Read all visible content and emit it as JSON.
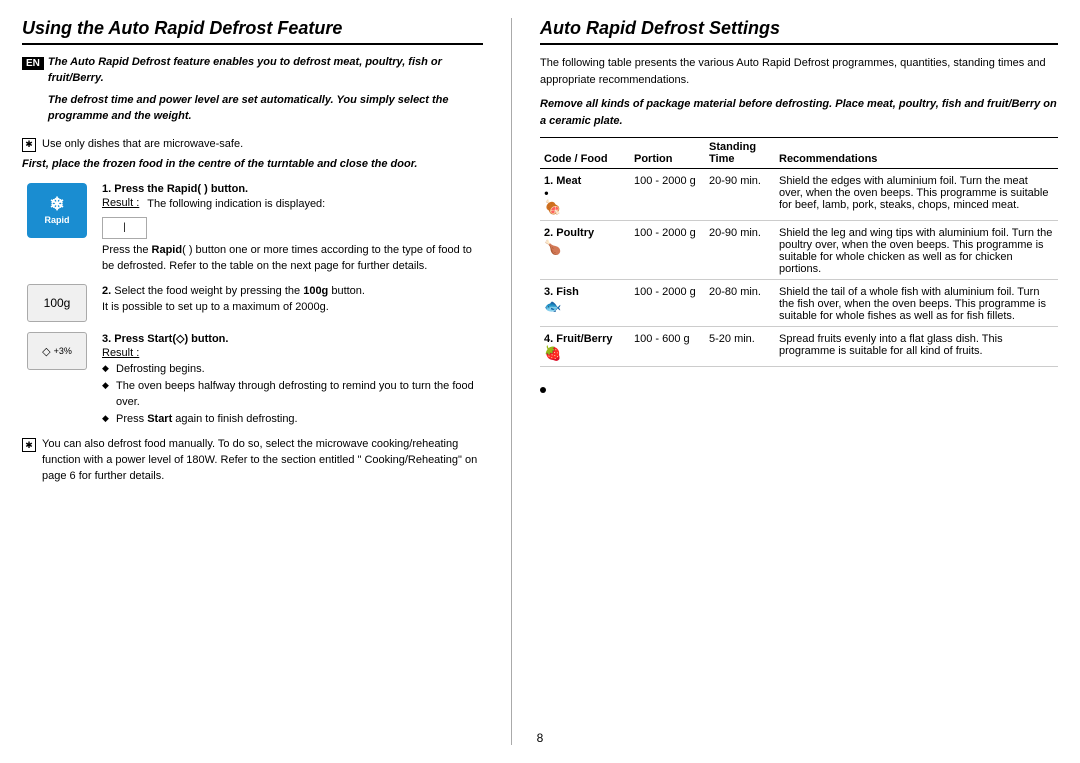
{
  "left": {
    "title": "Using the Auto Rapid Defrost Feature",
    "en_badge": "EN",
    "intro": {
      "line1": "The Auto Rapid Defrost feature enables you to defrost  meat, poultry, fish or fruit/Berry.",
      "line2": "The defrost time and power level are set automatically. You simply select the programme and the weight.",
      "note": "Use only dishes that are microwave-safe.",
      "line3": "First, place the frozen food in the centre of the turntable and close the door."
    },
    "steps": [
      {
        "number": "1.",
        "text_before": "Press the ",
        "bold_word": "Rapid",
        "bold_suffix": "(   ) button.",
        "result_label": "Result :",
        "result_text": "The following indication is displayed:",
        "sub_text": "Press the Rapid(   ) button one or more times according to the type of food to be defrosted. Refer to the table on the next page for further details."
      },
      {
        "number": "2.",
        "text": "Select the food weight by pressing the ",
        "bold_word": "100g",
        "text_after": " button.\nIt is possible to set up to a maximum of 2000g."
      },
      {
        "number": "3.",
        "text": "Press ",
        "bold_word": "Start",
        "text_after": "(   ) button.",
        "result_label": "Result :",
        "bullets": [
          "Defrosting begins.",
          "The oven beeps halfway through defrosting to remind you to turn the food over.",
          "Press Start again to finish defrosting."
        ]
      }
    ],
    "manual_note": "You can also defrost food manually. To do so, select the microwave cooking/reheating function with a power level of 180W. Refer to the section entitled \" Cooking/Reheating\" on page 6  for further details."
  },
  "right": {
    "title": "Auto Rapid Defrost Settings",
    "intro1": "The following table presents the various Auto Rapid Defrost programmes, quantities, standing times and appropriate recommendations.",
    "intro2": "Remove all kinds of package material before defrosting. Place meat, poultry, fish and fruit/Berry on a ceramic plate.",
    "table": {
      "headers": [
        "Code / Food",
        "Portion",
        "Standing\nTime",
        "Recommendations"
      ],
      "rows": [
        {
          "code": "1. Meat",
          "icon": "🍖",
          "portion": "100 - 2000 g",
          "standing": "20-90 min.",
          "rec": "Shield the edges with aluminium foil. Turn the meat over, when the oven beeps. This programme is suitable for beef, lamb, pork, steaks, chops, minced meat."
        },
        {
          "code": "2. Poultry",
          "icon": "🍗",
          "portion": "100 - 2000 g",
          "standing": "20-90 min.",
          "rec": "Shield the leg and wing tips with aluminium foil. Turn the poultry over, when the oven beeps. This programme is suitable for whole chicken as well as for chicken portions."
        },
        {
          "code": "3. Fish",
          "icon": "🐟",
          "portion": "100 - 2000 g",
          "standing": "20-80 min.",
          "rec": "Shield the tail of a whole fish with aluminium foil. Turn the fish over, when the oven beeps. This programme is suitable for whole fishes as well as for fish fillets."
        },
        {
          "code": "4. Fruit/Berry",
          "icon": "🍓",
          "portion": "100 - 600 g",
          "standing": "5-20 min.",
          "rec": "Spread fruits evenly into a flat glass dish. This programme is suitable for all kind of fruits."
        }
      ]
    }
  },
  "page_number": "8"
}
